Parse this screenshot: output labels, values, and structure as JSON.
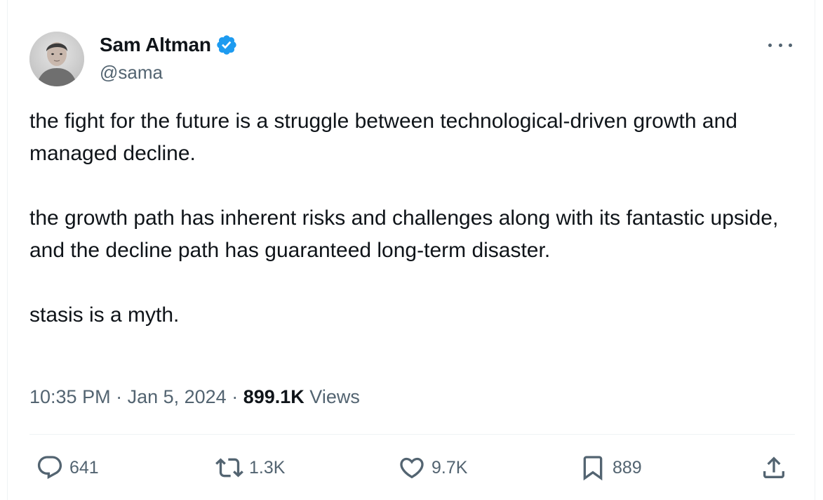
{
  "author": {
    "display_name": "Sam Altman",
    "handle": "@sama",
    "verified_icon": "verified-badge-icon",
    "verified_color": "#1d9bf0"
  },
  "tweet": {
    "paragraphs": [
      "the fight for the future is a struggle between technological-driven growth and managed decline.",
      "the growth path has inherent risks and challenges along with its fantastic upside, and the decline path has guaranteed long-term disaster.",
      "stasis is a myth."
    ],
    "time": "10:35 PM",
    "separator1": " · ",
    "date": "Jan 5, 2024",
    "separator2": " · ",
    "views_count": "899.1K",
    "views_label": "Views"
  },
  "actions": {
    "reply": {
      "icon": "reply-icon",
      "count": "641"
    },
    "retweet": {
      "icon": "retweet-icon",
      "count": "1.3K"
    },
    "like": {
      "icon": "heart-icon",
      "count": "9.7K"
    },
    "bookmark": {
      "icon": "bookmark-icon",
      "count": "889"
    },
    "share": {
      "icon": "share-icon"
    }
  },
  "colors": {
    "text_primary": "#0f1419",
    "text_secondary": "#536471",
    "divider": "#eff3f4"
  }
}
